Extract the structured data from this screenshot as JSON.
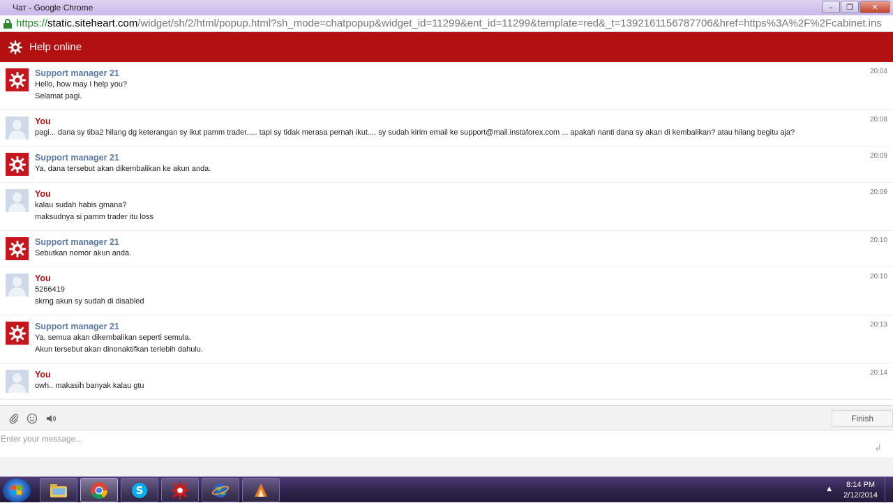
{
  "window": {
    "title": "Чат - Google Chrome",
    "controls": {
      "minimize": "–",
      "maximize": "❐",
      "close": "✕"
    }
  },
  "address": {
    "scheme": "https://",
    "host": "static.siteheart.com",
    "rest": "/widget/sh/2/html/popup.html?sh_mode=chatpopup&widget_id=11299&ent_id=11299&template=red&_t=1392161156787706&href=https%3A%2F%2Fcabinet.ins"
  },
  "header": {
    "title": "Help online",
    "logo_icon": "siteheart-logo-icon"
  },
  "colors": {
    "brand_red": "#b31111",
    "support_name": "#5a79a8",
    "user_name": "#b31111"
  },
  "messages": [
    {
      "author": "Support manager 21",
      "role": "support",
      "time": "20:04",
      "lines": [
        "Hello, how may I help you?",
        "Selamat pagi."
      ]
    },
    {
      "author": "You",
      "role": "user",
      "time": "20:08",
      "lines": [
        "pagi... dana sy tiba2 hilang dg keterangan sy ikut pamm trader..... tapi sy tidak merasa pernah ikut.... sy sudah kirim email ke support@mail.instaforex.com ... apakah nanti dana sy akan di kembalikan? atau hilang begitu aja?"
      ]
    },
    {
      "author": "Support manager 21",
      "role": "support",
      "time": "20:09",
      "lines": [
        "Ya, dana tersebut akan dikembalikan ke akun anda."
      ]
    },
    {
      "author": "You",
      "role": "user",
      "time": "20:09",
      "lines": [
        "kalau sudah habis gmana?",
        "maksudnya si pamm trader itu loss"
      ]
    },
    {
      "author": "Support manager 21",
      "role": "support",
      "time": "20:10",
      "lines": [
        "Sebutkan nomor akun anda."
      ]
    },
    {
      "author": "You",
      "role": "user",
      "time": "20:10",
      "lines": [
        "5266419",
        "skrng akun sy sudah di disabled"
      ]
    },
    {
      "author": "Support manager 21",
      "role": "support",
      "time": "20:13",
      "lines": [
        "Ya, semua akan dikembalikan seperti semula.",
        "Akun tersebut akan dinonaktifkan terlebih dahulu."
      ]
    },
    {
      "author": "You",
      "role": "user",
      "time": "20:14",
      "lines": [
        "owh.. makasih banyak kalau gtu"
      ]
    }
  ],
  "toolbar": {
    "attach_icon": "paperclip-icon",
    "smile_icon": "smiley-icon",
    "sound_icon": "speaker-icon",
    "finish_label": "Finish"
  },
  "input": {
    "placeholder": "Enter your message...",
    "enter_icon": "enter-icon"
  },
  "taskbar": {
    "apps": [
      "file-explorer",
      "chrome",
      "skype",
      "siteheart",
      "browser-globe",
      "app-orange"
    ],
    "time": "8:14 PM",
    "date": "2/12/2014"
  }
}
